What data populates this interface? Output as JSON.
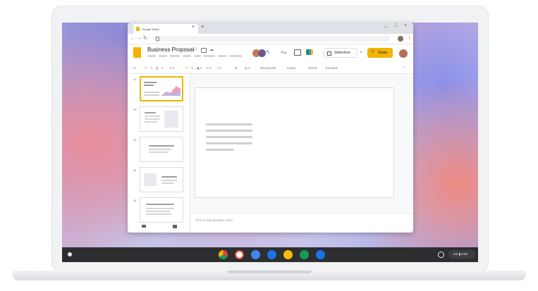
{
  "browser": {
    "tab_title": "Google Slides",
    "tab_close": "×",
    "new_tab": "+",
    "window_controls": [
      "_",
      "□",
      "×"
    ]
  },
  "document": {
    "title": "Business Proposal",
    "slideshow_label": "Slideshow",
    "share_label": "Share"
  },
  "toolbar": {
    "items": [
      "Background",
      "Layout",
      "Theme",
      "Transition"
    ]
  },
  "slides": {
    "numbers": [
      "12",
      "13",
      "14",
      "15",
      "16"
    ],
    "selected": "12"
  },
  "notes": {
    "placeholder": "Click to add speaker notes"
  },
  "shelf": {
    "apps": [
      "chrome-icon",
      "gmail-icon",
      "meet-icon",
      "photos-icon",
      "keep-icon",
      "sheets-icon",
      "files-icon"
    ],
    "status_text": "US ▮ 9:00",
    "colors": {
      "chrome": "#db4437",
      "gmail": "#ea4335",
      "meet": "#4285f4",
      "photos": "#1a73e8",
      "keep": "#fbbc04",
      "sheets": "#0f9d58",
      "files": "#1a73e8"
    }
  },
  "colors": {
    "accent": "#f4b400"
  }
}
